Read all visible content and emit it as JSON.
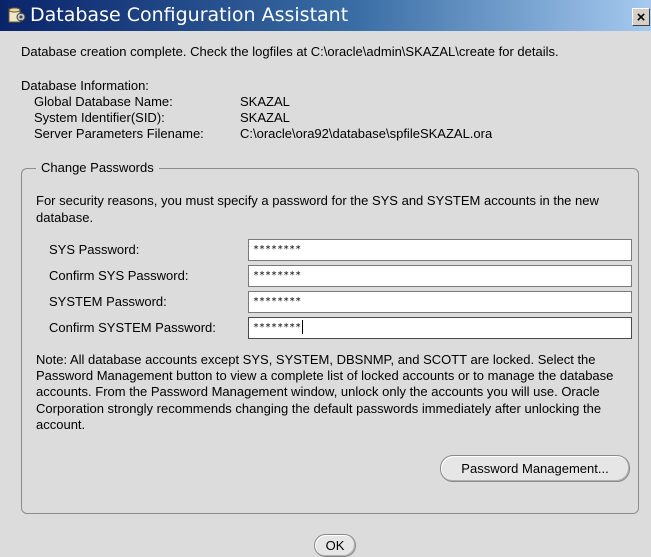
{
  "window": {
    "title": "Database Configuration Assistant",
    "close_glyph": "×",
    "icon": "database-icon"
  },
  "status_message": "Database creation complete. Check the logfiles at C:\\oracle\\admin\\SKAZAL\\create for details.",
  "database_info": {
    "heading": "Database Information:",
    "rows": [
      {
        "label": "Global Database Name:",
        "value": "SKAZAL"
      },
      {
        "label": "System Identifier(SID):",
        "value": "SKAZAL"
      },
      {
        "label": "Server Parameters Filename:",
        "value": "C:\\oracle\\ora92\\database\\spfileSKAZAL.ora"
      }
    ]
  },
  "change_passwords": {
    "group_title": "Change Passwords",
    "security_text": "For security reasons, you must specify a password for the SYS and SYSTEM accounts in the new database.",
    "fields": [
      {
        "label": "SYS Password:",
        "value": "********"
      },
      {
        "label": "Confirm SYS Password:",
        "value": "********"
      },
      {
        "label": "SYSTEM Password:",
        "value": "********"
      },
      {
        "label": "Confirm SYSTEM Password:",
        "value": "********"
      }
    ],
    "note": "Note: All database accounts except SYS, SYSTEM, DBSNMP, and SCOTT are locked. Select the Password Management button to view a complete list of locked accounts or to manage the database accounts. From the Password Management window, unlock only the accounts you will use. Oracle Corporation strongly recommends changing the default passwords immediately after unlocking the account.",
    "password_management_label": "Password Management..."
  },
  "ok_label": "OK",
  "colors": {
    "titlebar_start": "#0a246a",
    "titlebar_end": "#a6caf0",
    "dialog_bg": "#dcdcdc"
  }
}
